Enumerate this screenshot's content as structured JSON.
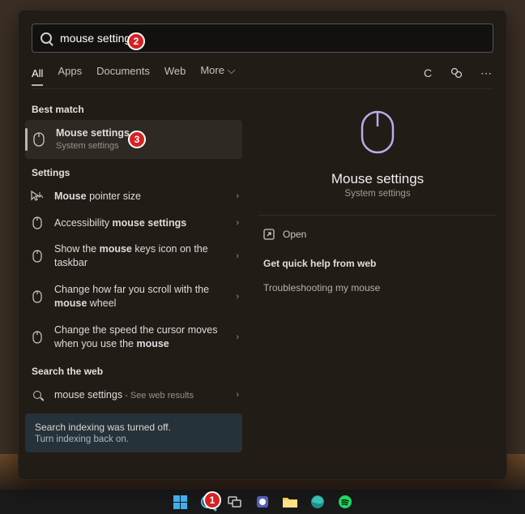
{
  "search": {
    "query": "mouse settings"
  },
  "tabs": {
    "all": "All",
    "apps": "Apps",
    "documents": "Documents",
    "web": "Web",
    "more": "More"
  },
  "left": {
    "bestMatchHdr": "Best match",
    "bestMatch": {
      "title": "Mouse settings",
      "sub": "System settings"
    },
    "settingsHdr": "Settings",
    "settings": [
      {
        "pre": "",
        "b": "Mouse",
        "post": " pointer size"
      },
      {
        "pre": "Accessibility ",
        "b": "mouse settings",
        "post": ""
      },
      {
        "pre": "Show the ",
        "b": "mouse",
        "post": " keys icon on the taskbar"
      },
      {
        "pre": "Change how far you scroll with the ",
        "b": "mouse",
        "post": " wheel"
      },
      {
        "pre": "Change the speed the cursor moves when you use the ",
        "b": "mouse",
        "post": ""
      }
    ],
    "webHdr": "Search the web",
    "webRow": {
      "q": "mouse settings",
      "hint": " - See web results"
    },
    "banner": {
      "l1": "Search indexing was turned off.",
      "l2": "Turn indexing back on."
    }
  },
  "right": {
    "title": "Mouse settings",
    "sub": "System settings",
    "open": "Open",
    "quickHdr": "Get quick help from web",
    "links": [
      "Troubleshooting my mouse"
    ]
  },
  "annots": {
    "1": "1",
    "2": "2",
    "3": "3"
  }
}
